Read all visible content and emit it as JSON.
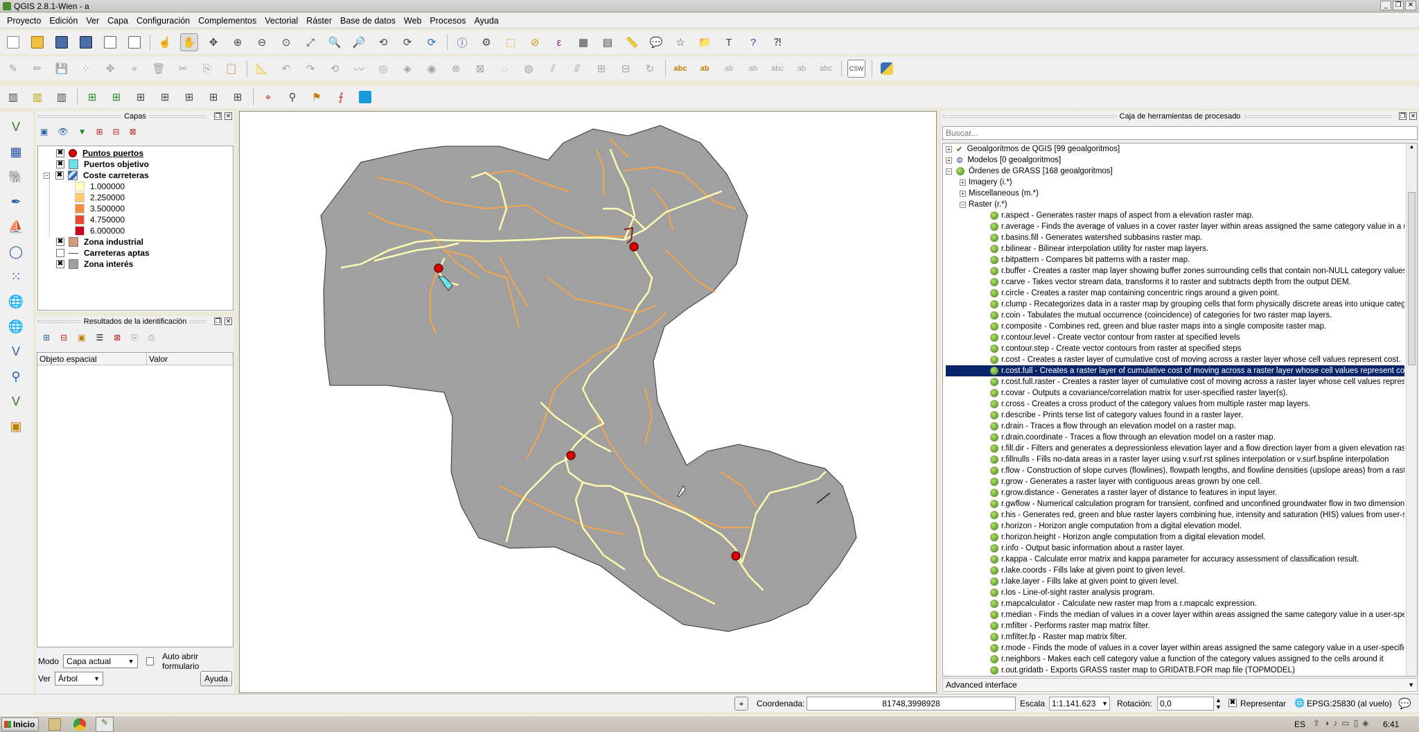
{
  "window": {
    "title": "QGIS 2.8.1-Wien - a"
  },
  "menu": [
    "Proyecto",
    "Edición",
    "Ver",
    "Capa",
    "Configuración",
    "Complementos",
    "Vectorial",
    "Ráster",
    "Base de datos",
    "Web",
    "Procesos",
    "Ayuda"
  ],
  "layers_panel": {
    "title": "Capas",
    "layers": [
      {
        "name": "Puntos puertos",
        "checked": true,
        "bold": true,
        "underline": true,
        "symbol": "red-dot"
      },
      {
        "name": "Puertos objetivo",
        "checked": true,
        "bold": true,
        "symbol": "cyan-square"
      },
      {
        "name": "Coste carreteras",
        "checked": true,
        "bold": true,
        "symbol": "raster",
        "expanded": true,
        "legend": [
          {
            "label": "1.000000",
            "color": "#ffffbe"
          },
          {
            "label": "2.250000",
            "color": "#fecb6b"
          },
          {
            "label": "3.500000",
            "color": "#f78c3c"
          },
          {
            "label": "4.750000",
            "color": "#e84a2d"
          },
          {
            "label": "6.000000",
            "color": "#c8001e"
          }
        ]
      },
      {
        "name": "Zona industrial",
        "checked": true,
        "bold": true,
        "symbol": "tan-square"
      },
      {
        "name": "Carreteras aptas",
        "checked": false,
        "bold": true,
        "symbol": "line"
      },
      {
        "name": "Zona interés",
        "checked": true,
        "bold": true,
        "symbol": "gray-square"
      }
    ]
  },
  "identify_panel": {
    "title": "Resultados de la identificación",
    "col_feature": "Objeto espacial",
    "col_value": "Valor",
    "mode_label": "Modo",
    "mode_value": "Capa actual",
    "auto_open_label": "Auto abrir formulario",
    "view_label": "Ver",
    "view_value": "Árbol",
    "help_button": "Ayuda"
  },
  "processing": {
    "title": "Caja de herramientas de procesado",
    "search_placeholder": "Buscar...",
    "groups": [
      {
        "label": "Geoalgoritmos de QGIS [99 geoalgoritmos]"
      },
      {
        "label": "Modelos [0 geoalgoritmos]"
      },
      {
        "label": "Órdenes de GRASS [168 geoalgoritmos]"
      }
    ],
    "subgroups": [
      "Imagery (i.*)",
      "Miscellaneous (m.*)",
      "Raster (r.*)"
    ],
    "algorithms": [
      "r.aspect - Generates raster maps of aspect from a elevation raster map.",
      "r.average - Finds the average of values in a cover raster layer  within areas assigned the same category value in a use...",
      "r.basins.fill - Generates watershed subbasins raster map.",
      "r.bilinear - Bilinear interpolation utility for raster map layers.",
      "r.bitpattern - Compares bit patterns with a raster map.",
      "r.buffer - Creates a raster map layer showing buffer zones surrounding cells that contain non-NULL category values.",
      "r.carve - Takes vector stream data, transforms it to raster and subtracts depth from the output DEM.",
      "r.circle - Creates a raster map containing concentric rings around a given point.",
      "r.clump - Recategorizes data in a raster map by grouping cells that form physically discrete areas into unique categories.",
      "r.coin - Tabulates the mutual occurrence (coincidence) of categories for two raster map layers.",
      "r.composite - Combines red, green and blue raster maps into a single composite raster map.",
      "r.contour.level - Create vector contour from raster at specified levels",
      "r.contour.step - Create vector contours from raster at specified steps",
      "r.cost - Creates a raster layer of cumulative cost of moving across a raster layer whose cell values represent cost.",
      "r.cost.full - Creates a raster layer of cumulative cost of moving across a raster layer whose cell values represent cost.",
      "r.cost.full.raster - Creates a raster layer of cumulative cost of moving across a raster layer whose cell values represent...",
      "r.covar - Outputs a covariance/correlation matrix for user-specified raster layer(s).",
      "r.cross - Creates a cross product of the category values from multiple raster map layers.",
      "r.describe - Prints terse list of category values found in a raster layer.",
      "r.drain - Traces a flow through an elevation model on a raster map.",
      "r.drain.coordinate - Traces a flow through an elevation model on a raster map.",
      "r.fill.dir - Filters and generates a depressionless elevation layer and a flow direction layer from a given elevation raster l...",
      "r.fillnulls - Fills no-data areas in a raster layer using v.surf.rst splines interpolation or v.surf.bspline interpolation",
      "r.flow - Construction of slope curves (flowlines), flowpath lengths, and flowline densities (upslope areas) from a raster ...",
      "r.grow - Generates a raster layer with contiguous areas grown by one cell.",
      "r.grow.distance - Generates a raster layer of distance to features in input layer.",
      "r.gwflow - Numerical calculation program for transient, confined and unconfined groundwater flow in two dimensions.",
      "r.his - Generates red, green and blue raster layers combining hue, intensity and saturation (HIS) values from user-speci...",
      "r.horizon - Horizon angle computation from a digital elevation model.",
      "r.horizon.height - Horizon angle computation from a digital elevation model.",
      "r.info - Output basic information about a raster layer.",
      "r.kappa - Calculate error matrix and kappa parameter for accuracy assessment of classification result.",
      "r.lake.coords - Fills lake at given point to given level.",
      "r.lake.layer - Fills lake at given point to given level.",
      "r.los - Line-of-sight raster analysis program.",
      "r.mapcalculator - Calculate new raster map from a r.mapcalc expression.",
      "r.median - Finds the median of values in a cover layer within areas assigned the same category value in a user-specified...",
      "r.mfilter - Performs raster map matrix filter.",
      "r.mfilter.fp - Raster map matrix filter.",
      "r.mode - Finds the mode of values in a cover layer within areas assigned the same category value in a user-specified ba...",
      "r.neighbors - Makes each cell category value a function of the category values assigned to the cells around it",
      "r.out.gridatb - Exports GRASS raster map to GRIDATB.FOR map file (TOPMODEL)"
    ],
    "selected_index": 14,
    "advanced_label": "Advanced interface"
  },
  "statusbar": {
    "coord_label": "Coordenada:",
    "coord_value": "81748,3998928",
    "scale_label": "Escala",
    "scale_value": "1:1.141.623",
    "rotation_label": "Rotación:",
    "rotation_value": "0,0",
    "render_label": "Representar",
    "crs_label": "EPSG:25830 (al vuelo)"
  },
  "taskbar": {
    "start": "Inicio",
    "lang": "ES",
    "time": "6:41"
  },
  "map": {
    "fill_color": "#a0a0a0",
    "stroke_color": "#333333",
    "road_light": "#fdfbb0",
    "road_orange": "#f5a54a",
    "port_color": "#dd0000"
  }
}
